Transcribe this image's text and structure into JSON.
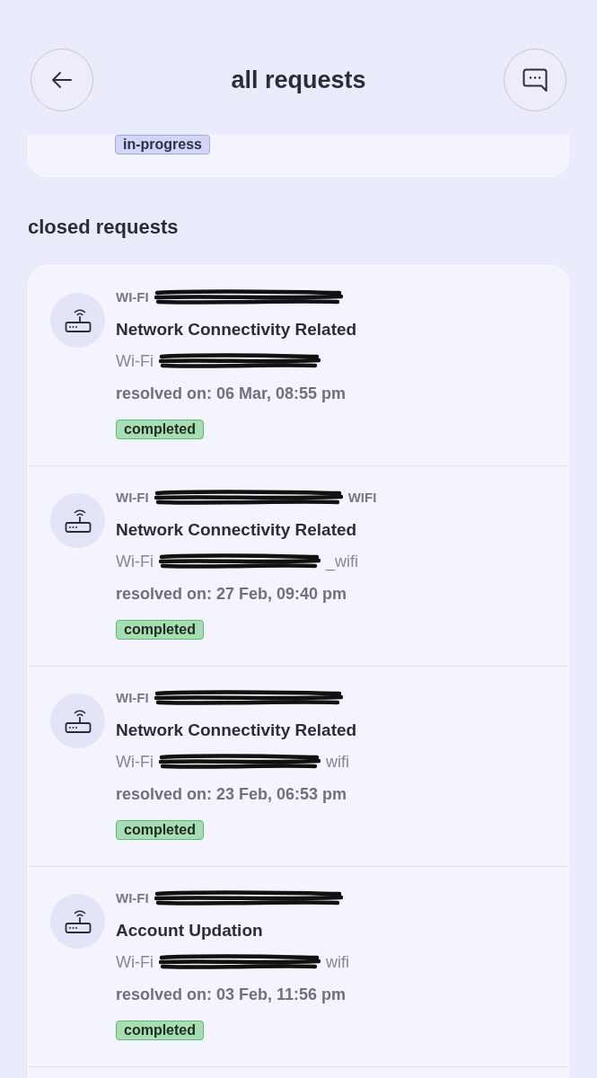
{
  "header": {
    "title": "all requests"
  },
  "open_requests": [
    {
      "status": {
        "label": "in-progress",
        "kind": "progress"
      }
    }
  ],
  "closed_requests": {
    "heading": "closed requests",
    "items": [
      {
        "network_id": {
          "prefix": "WI-FI",
          "redacted": true
        },
        "category": "Network Connectivity Related",
        "ssid": {
          "prefix": "Wi-Fi",
          "redacted": true
        },
        "resolved": "resolved on: 06 Mar, 08:55 pm",
        "status": {
          "label": "completed",
          "kind": "completed"
        }
      },
      {
        "network_id": {
          "prefix": "WI-FI",
          "redacted": true,
          "suffix": "WIFI"
        },
        "category": "Network Connectivity Related",
        "ssid": {
          "prefix": "Wi-Fi",
          "redacted": true,
          "suffix": "_wifi"
        },
        "resolved": "resolved on: 27 Feb, 09:40 pm",
        "status": {
          "label": "completed",
          "kind": "completed"
        }
      },
      {
        "network_id": {
          "prefix": "WI-FI",
          "redacted": true
        },
        "category": "Network Connectivity Related",
        "ssid": {
          "prefix": "Wi-Fi",
          "redacted": true,
          "suffix": "wifi"
        },
        "resolved": "resolved on: 23 Feb, 06:53 pm",
        "status": {
          "label": "completed",
          "kind": "completed"
        }
      },
      {
        "network_id": {
          "prefix": "WI-FI",
          "redacted": true
        },
        "category": "Account Updation",
        "ssid": {
          "prefix": "Wi-Fi",
          "redacted": true,
          "suffix": "wifi"
        },
        "resolved": "resolved on: 03 Feb, 11:56 pm",
        "status": {
          "label": "completed",
          "kind": "completed"
        }
      }
    ]
  }
}
